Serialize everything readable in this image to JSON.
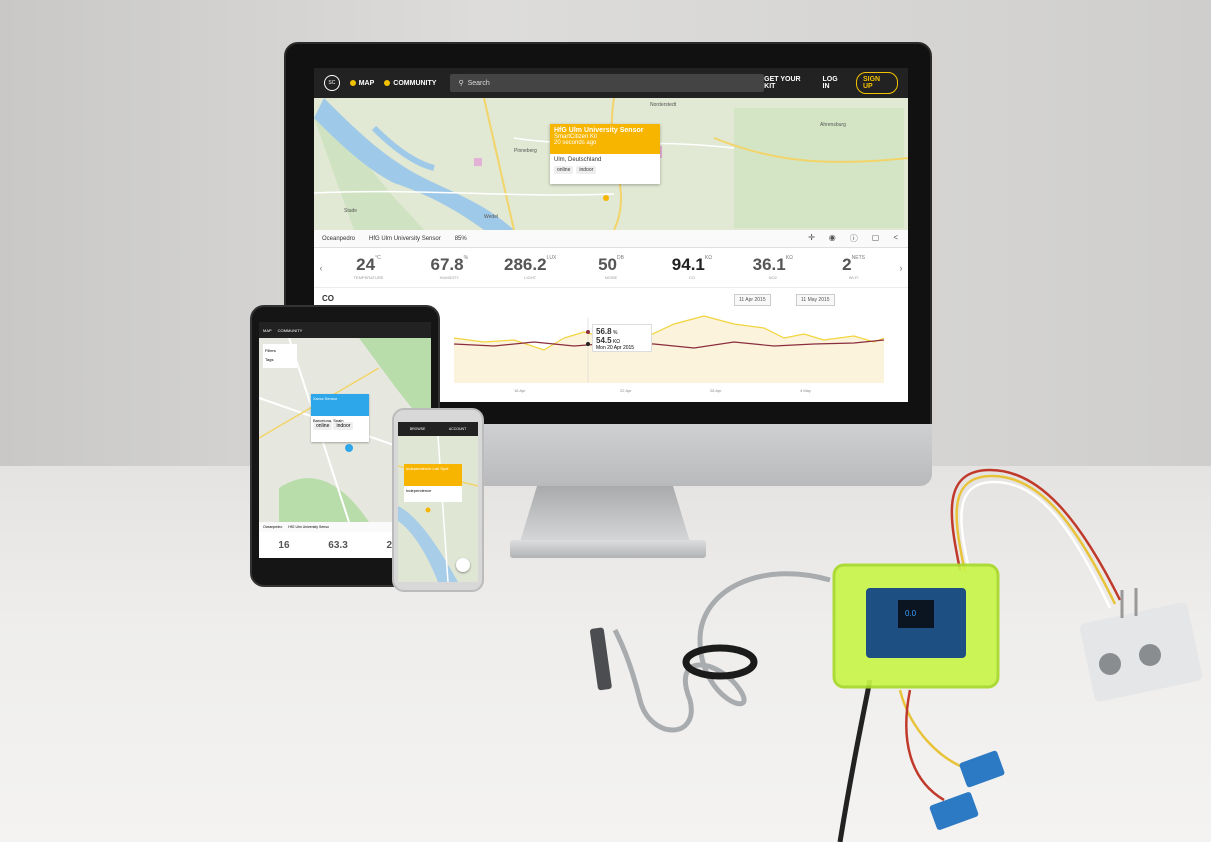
{
  "app": {
    "nav": {
      "map_label": "MAP",
      "community_label": "COMMUNITY",
      "search_placeholder": "Search",
      "get_kit_label": "GET YOUR KIT",
      "login_label": "LOG IN",
      "signup_label": "SIGN UP"
    },
    "map_popup": {
      "title": "HfG Ulm University Sensor",
      "subtitle": "SmartCitizen Kit",
      "time": "20 seconds ago",
      "location": "Ulm, Deutschland",
      "tags": [
        "online",
        "indoor"
      ]
    },
    "map_labels": [
      "Norderstedt",
      "Ahrensburg",
      "Stade",
      "Wedel",
      "Pinneberg"
    ],
    "kit_bar": {
      "owner": "Oceanpedro",
      "kit_name": "HfG Ulm University Sensor",
      "battery": "85%"
    },
    "readings": [
      {
        "value": "24",
        "unit": "°C",
        "name": "TEMPERATURE"
      },
      {
        "value": "67.8",
        "unit": "%",
        "name": "HUMIDITY"
      },
      {
        "value": "286.2",
        "unit": "LUX",
        "name": "LIGHT"
      },
      {
        "value": "50",
        "unit": "DB",
        "name": "NOISE"
      },
      {
        "value": "94.1",
        "unit": "KΩ",
        "name": "CO"
      },
      {
        "value": "36.1",
        "unit": "KΩ",
        "name": "NO2"
      },
      {
        "value": "2",
        "unit": "NETS",
        "name": "WI-FI"
      }
    ],
    "chart": {
      "title": "CO",
      "date_from": "11 Apr 2015",
      "date_to": "11 May 2015",
      "tooltip_a": "56.8",
      "tooltip_a_unit": "%",
      "tooltip_b": "54.5",
      "tooltip_b_unit": "KΩ",
      "tooltip_date": "Mon 20 Apr 2015",
      "xticks": [
        "16 Apr",
        "22 Apr",
        "28 Apr",
        "4 May"
      ]
    }
  },
  "tablet": {
    "nav_map": "MAP",
    "nav_community": "COMMUNITY",
    "filters": "Filters",
    "tags": "Tags",
    "popup_title": "Xarxa Sensor",
    "popup_location": "Barcelona, Spain",
    "popup_tags": [
      "online",
      "indoor"
    ],
    "bar_owner": "Oceanpedro",
    "bar_kit": "HfG Ulm University Senso",
    "readings": [
      "16",
      "63.3",
      "283.2"
    ]
  },
  "phone": {
    "nav_left": "BROWSE",
    "nav_right": "ACCOUNT",
    "popup_title": "Independence Lab Spot",
    "popup_location": "Independence"
  }
}
